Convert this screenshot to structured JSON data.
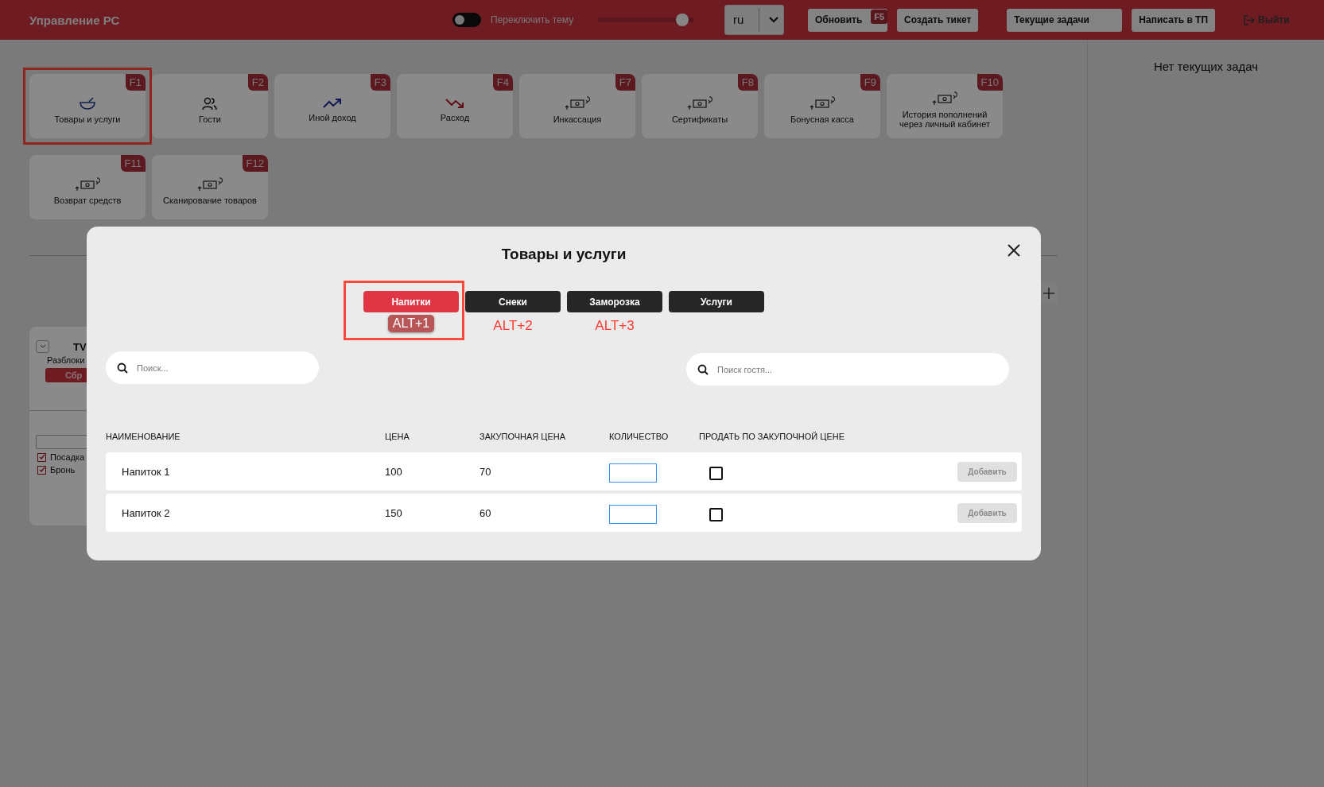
{
  "header": {
    "title": "Управление РС",
    "theme_toggle": {
      "label": "Переключить тему",
      "on": false
    },
    "slider": {
      "level": 0.88
    },
    "language": {
      "value": "ru"
    },
    "buttons": [
      {
        "label": "Обновить",
        "hotkey": "F5"
      },
      {
        "label": "Создать тикет"
      },
      {
        "label": "Текущие задачи"
      },
      {
        "label": "Написать в ТП"
      }
    ],
    "logout": {
      "label": "Выйти"
    }
  },
  "tiles": [
    {
      "label": "Товары и услуги",
      "hotkey": "F1",
      "kind": "bowl",
      "highlighted": true
    },
    {
      "label": "Гости",
      "hotkey": "F2",
      "kind": "people",
      "highlighted": false
    },
    {
      "label": "Иной доход",
      "hotkey": "F3",
      "kind": "trend-up",
      "highlighted": false
    },
    {
      "label": "Расход",
      "hotkey": "F4",
      "kind": "trend-down",
      "highlighted": false
    },
    {
      "label": "Инкассация",
      "hotkey": "F7",
      "kind": "money",
      "highlighted": false
    },
    {
      "label": "Сертификаты",
      "hotkey": "F8",
      "kind": "money",
      "highlighted": false
    },
    {
      "label": "Бонусная касса",
      "hotkey": "F9",
      "kind": "money",
      "highlighted": false
    },
    {
      "label": "История пополнений через личный кабинет",
      "hotkey": "F10",
      "kind": "money",
      "highlighted": false
    },
    {
      "label": "Возврат средств",
      "hotkey": "F11",
      "kind": "money",
      "highlighted": false
    },
    {
      "label": "Сканирование товаров",
      "hotkey": "F12",
      "kind": "money",
      "highlighted": false
    }
  ],
  "pc_card": {
    "title": "TV",
    "status": "Разблоки",
    "button": "Сбр",
    "checkboxes": [
      {
        "label": "Посадка",
        "checked": true
      },
      {
        "label": "Бронь",
        "checked": true
      }
    ]
  },
  "tasks_panel": {
    "empty_text": "Нет текущих задач"
  },
  "modal": {
    "title": "Товары и услуги",
    "tabs": [
      {
        "label": "Напитки",
        "hotkey": "ALT+1",
        "selected": true,
        "highlighted": true
      },
      {
        "label": "Снеки",
        "hotkey": "ALT+2",
        "selected": false,
        "highlighted": false
      },
      {
        "label": "Заморозка",
        "hotkey": "ALT+3",
        "selected": false,
        "highlighted": false
      },
      {
        "label": "Услуги",
        "selected": false,
        "highlighted": false
      }
    ],
    "search": {
      "placeholder": "Поиск..."
    },
    "guest_search": {
      "placeholder": "Поиск гостя..."
    },
    "columns": [
      "НАИМЕНОВАНИЕ",
      "ЦЕНА",
      "ЗАКУПОЧНАЯ ЦЕНА",
      "КОЛИЧЕСТВО",
      "ПРОДАТЬ ПО ЗАКУПОЧНОЙ ЦЕНЕ"
    ],
    "rows": [
      {
        "name": "Напиток 1",
        "price": "100",
        "purchase_price": "70",
        "sell_at_purchase": false,
        "action": "Добавить",
        "disabled": true
      },
      {
        "name": "Напиток 2",
        "price": "150",
        "purchase_price": "60",
        "sell_at_purchase": false,
        "action": "Добавить",
        "disabled": true
      }
    ]
  }
}
